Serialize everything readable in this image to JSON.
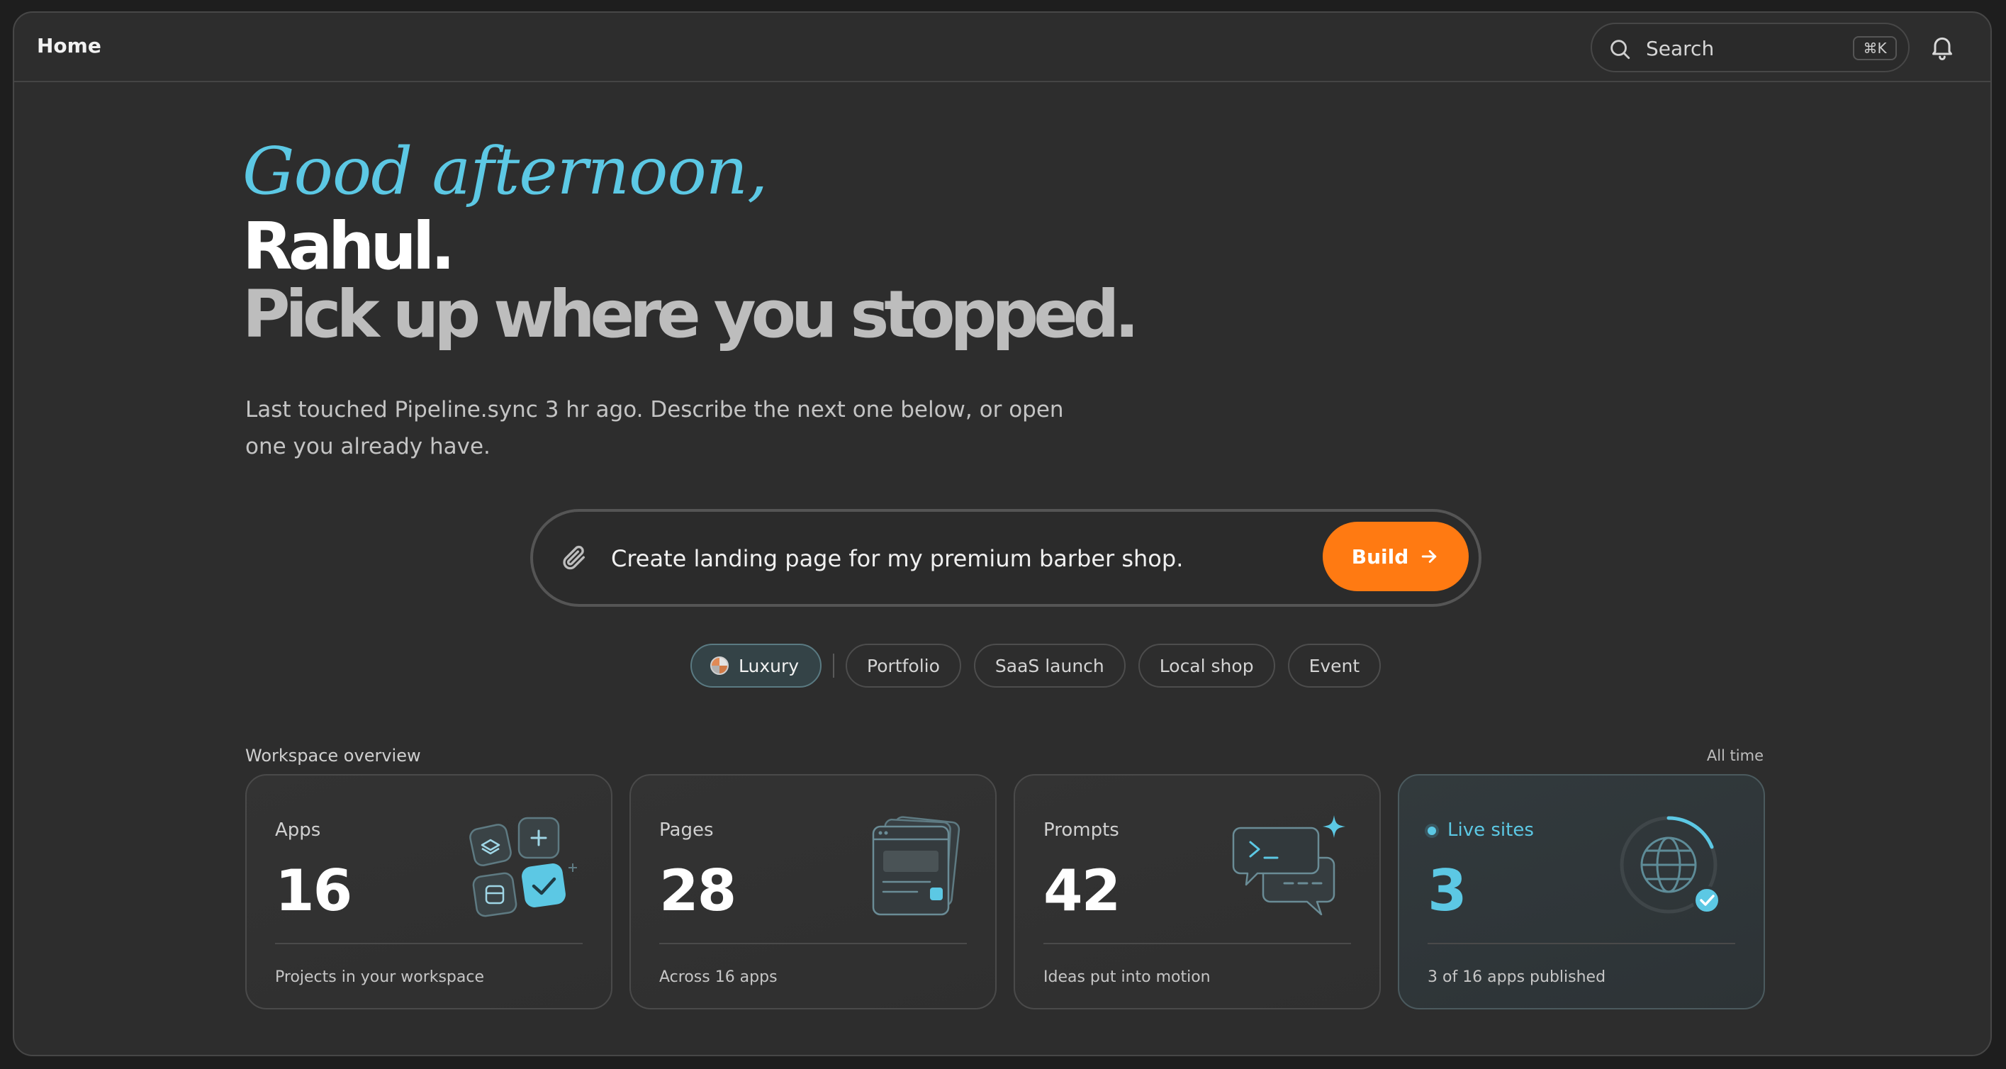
{
  "topbar": {
    "title": "Home",
    "search": {
      "placeholder": "Search",
      "shortcut": "⌘K"
    }
  },
  "hero": {
    "greeting": "Good afternoon,",
    "name": "Rahul.",
    "headline": "Pick up where you stopped.",
    "lede": "Last touched Pipeline.sync 3 hr ago. Describe the next one below, or open one you already have."
  },
  "prompt": {
    "value": "Create landing page for my premium barber shop.",
    "build_label": "Build"
  },
  "chips": [
    {
      "label": "Luxury",
      "active": true
    },
    {
      "label": "Portfolio",
      "active": false
    },
    {
      "label": "SaaS launch",
      "active": false
    },
    {
      "label": "Local shop",
      "active": false
    },
    {
      "label": "Event",
      "active": false
    }
  ],
  "workspace": {
    "title": "Workspace overview",
    "range": "All time",
    "cards": [
      {
        "label": "Apps",
        "value": "16",
        "note": "Projects in your workspace",
        "icon": "apps-icon"
      },
      {
        "label": "Pages",
        "value": "28",
        "note": "Across 16 apps",
        "icon": "pages-icon"
      },
      {
        "label": "Prompts",
        "value": "42",
        "note": "Ideas put into motion",
        "icon": "prompts-icon"
      },
      {
        "label": "Live sites",
        "value": "3",
        "note": "3 of 16 apps published",
        "icon": "globe-icon",
        "progress": 0.1875
      }
    ]
  },
  "colors": {
    "accent": "#5cc8e4",
    "build": "#ff7a12",
    "background": "#2d2d2d"
  }
}
